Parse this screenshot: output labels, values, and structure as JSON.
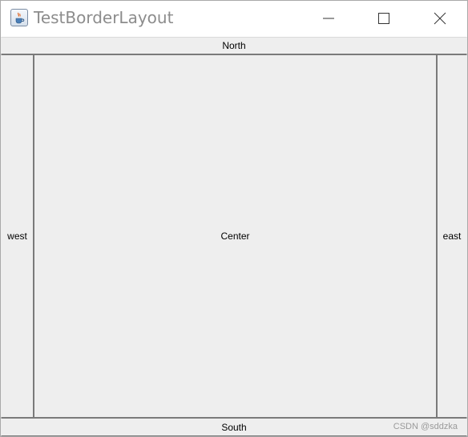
{
  "window": {
    "title": "TestBorderLayout",
    "icon": "java-cup-icon"
  },
  "controls": {
    "minimize": "minimize-icon",
    "maximize": "maximize-icon",
    "close": "close-icon"
  },
  "layout": {
    "north": "North",
    "west": "west",
    "center": "Center",
    "east": "east",
    "south": "South"
  },
  "watermark": "CSDN @sddzka"
}
